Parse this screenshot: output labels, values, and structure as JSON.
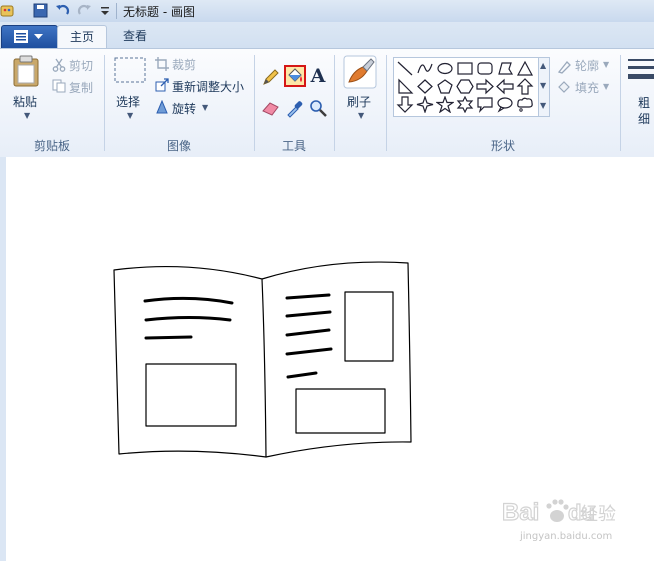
{
  "window": {
    "title": "无标题 - 画图"
  },
  "tabs": [
    {
      "label": "主页",
      "active": true
    },
    {
      "label": "查看",
      "active": false
    }
  ],
  "clipboard": {
    "paste_label": "粘贴",
    "cut_label": "剪切",
    "copy_label": "复制",
    "group_label": "剪贴板"
  },
  "image": {
    "select_label": "选择",
    "crop_label": "裁剪",
    "resize_label": "重新调整大小",
    "rotate_label": "旋转",
    "group_label": "图像"
  },
  "tools": {
    "group_label": "工具",
    "items": [
      {
        "icon": "pencil-icon"
      },
      {
        "icon": "fill-bucket-icon",
        "selected": true
      },
      {
        "icon": "text-icon",
        "glyph": "A"
      },
      {
        "icon": "eraser-icon"
      },
      {
        "icon": "color-picker-icon"
      },
      {
        "icon": "magnifier-icon"
      }
    ]
  },
  "brushes": {
    "label": "刷子"
  },
  "shapes": {
    "group_label": "形状",
    "outline_label": "轮廓",
    "fill_label": "填充"
  },
  "size": {
    "label_line1": "粗",
    "label_line2": "细"
  },
  "watermark": {
    "brand": "Bai du 经验",
    "url": "jingyan.baidu.com"
  },
  "colors": {
    "accent": "#1e4f9f",
    "selected_border": "#d51616",
    "ribbon_text": "#1e395b"
  }
}
